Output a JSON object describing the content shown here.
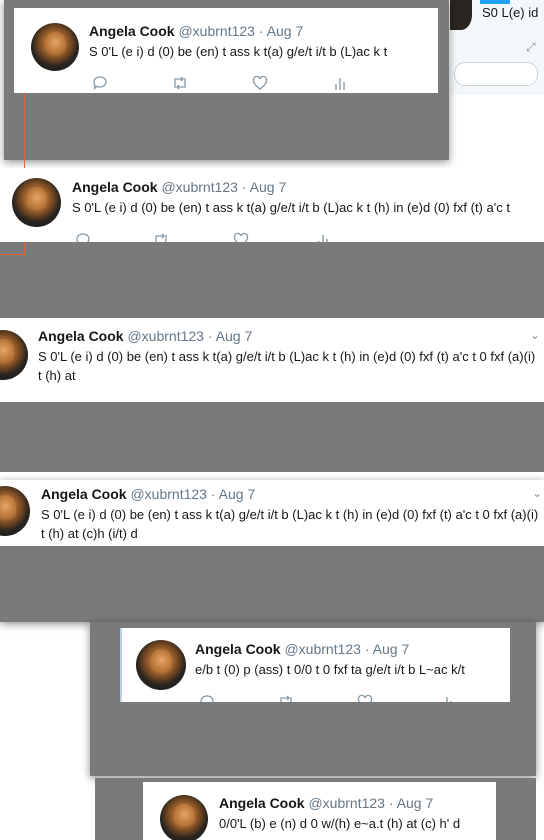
{
  "tweets": [
    {
      "name": "Angela Cook",
      "handle": "@xubrnt123",
      "separator": "·",
      "date": "Aug 7",
      "text": "S 0'L (e i) d (0) be (en) t ass k t(a) g/e/t i/t b (L)ac k t"
    },
    {
      "name": "Angela Cook",
      "handle": "@xubrnt123",
      "separator": "·",
      "date": "Aug 7",
      "text": "S 0'L (e i) d (0) be (en) t ass k t(a) g/e/t i/t b (L)ac k t (h) in (e)d (0) fxf (t) a'c t"
    },
    {
      "name": "Angela Cook",
      "handle": "@xubrnt123",
      "separator": "·",
      "date": "Aug 7",
      "text": "S 0'L (e i) d (0) be (en) t ass k t(a) g/e/t i/t b (L)ac k t (h) in (e)d (0) fxf (t) a'c t 0 fxf (a)(i) t (h) at"
    },
    {
      "name": "Angela Cook",
      "handle": "@xubrnt123",
      "separator": "·",
      "date": "Aug 7",
      "text": "S 0'L (e i) d (0) be (en) t ass k t(a) g/e/t i/t b (L)ac k t (h) in (e)d (0) fxf (t) a'c t 0 fxf (a)(i) t (h) at (c)h (i/t) d"
    },
    {
      "name": "Angela Cook",
      "handle": "@xubrnt123",
      "separator": "·",
      "date": "Aug 7",
      "text": "e/b t (0) p (ass) t 0/0 t 0 fxf ta g/e/t i/t b L~ac k/t"
    },
    {
      "name": "Angela Cook",
      "handle": "@xubrnt123",
      "separator": "·",
      "date": "Aug 7",
      "text": "0/0'L (b) e (n) d 0 w/(h) e~a.t (h) at (c) h' d"
    }
  ],
  "background_fragment_text": "S0 L(e) id",
  "icons": {
    "reply": "reply-icon",
    "retweet": "retweet-icon",
    "like": "heart-icon",
    "analytics": "analytics-icon",
    "caret": "chevron-down-icon",
    "expand": "expand-icon"
  },
  "colors": {
    "gray_overlay": "#7a7a7a",
    "orange_border": "#e0622d",
    "icon_gray": "#8899a6",
    "secondary_text": "#657786"
  }
}
